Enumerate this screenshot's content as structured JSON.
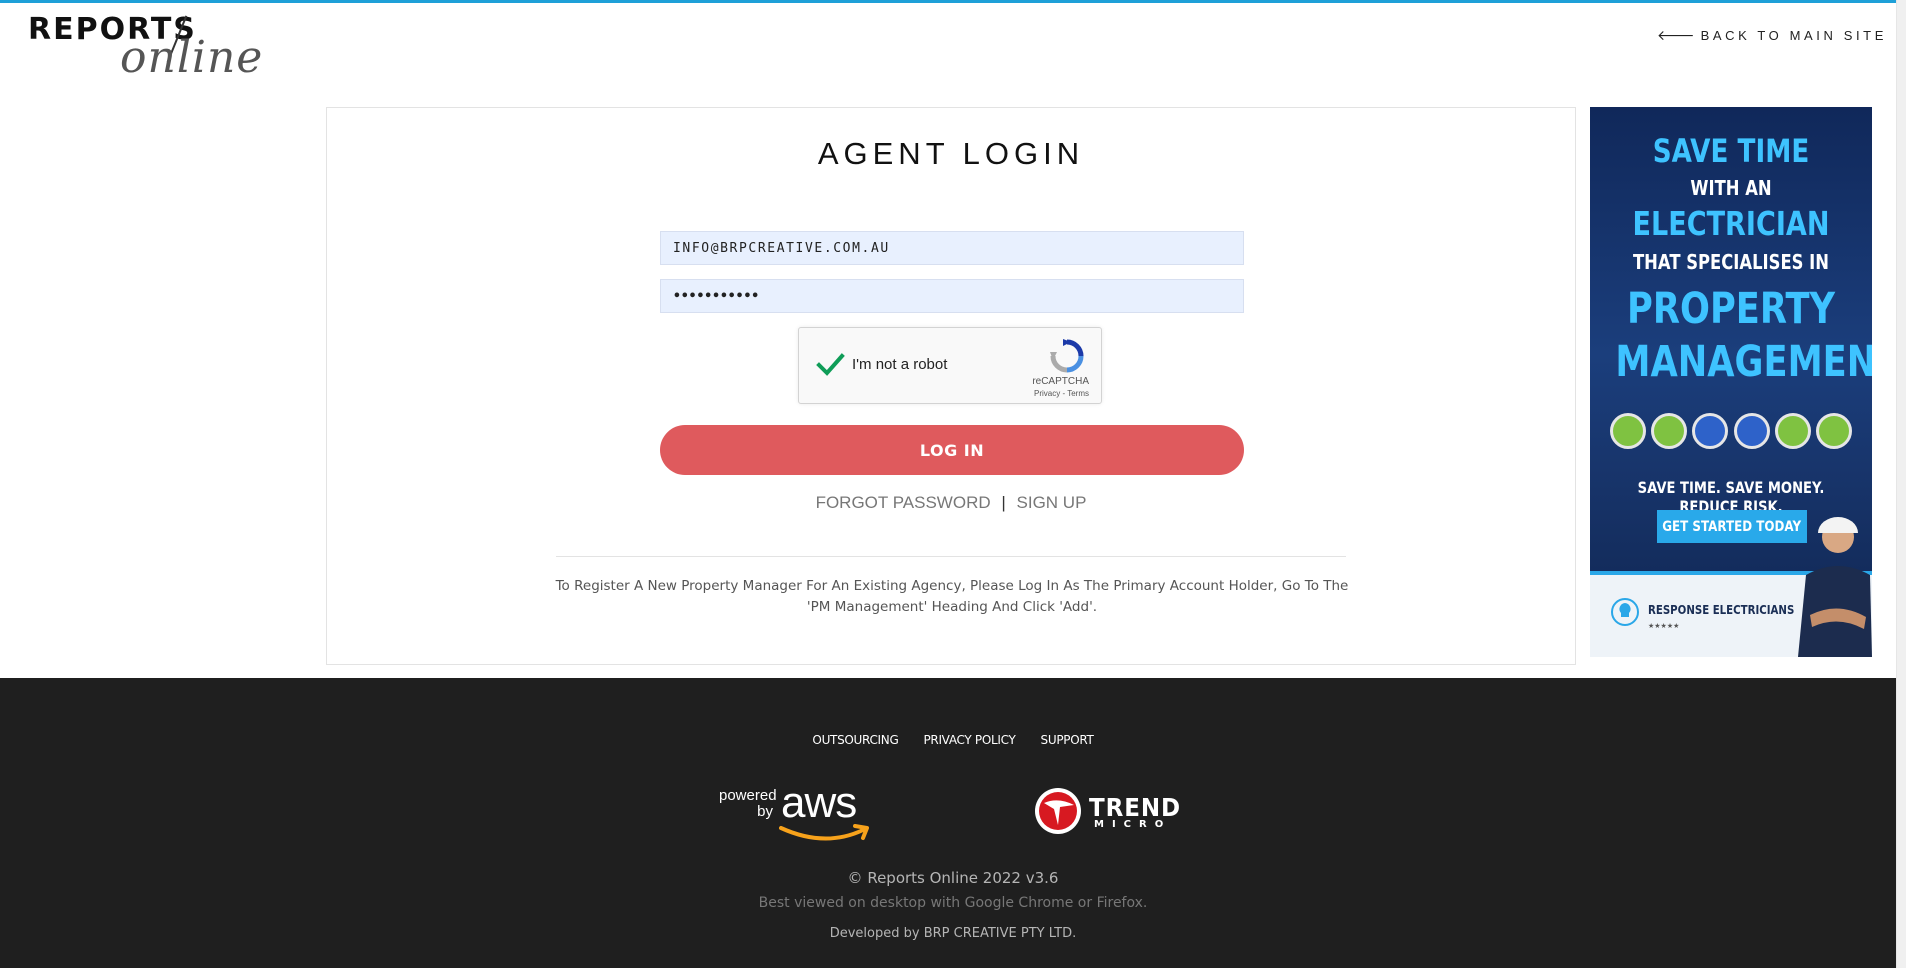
{
  "header": {
    "logo_main": "REPORTS",
    "logo_script": "online",
    "back_link": "BACK TO MAIN SITE",
    "back_icon": "arrow-left-icon"
  },
  "login": {
    "title": "AGENT LOGIN",
    "email_value": "INFO@BRPCREATIVE.COM.AU",
    "password_value": "•••••••••••",
    "captcha": {
      "label": "I'm not a robot",
      "brand": "reCAPTCHA",
      "links": "Privacy - Terms",
      "checked": true
    },
    "login_button": "LOG IN",
    "forgot_password": "FORGOT PASSWORD",
    "separator": "|",
    "sign_up": "SIGN UP",
    "note": "To Register A New Property Manager For An Existing Agency, Please Log In As The Primary Account Holder, Go To The 'PM Management' Heading And Click 'Add'."
  },
  "ad": {
    "line1": "SAVE TIME",
    "line2": "WITH AN",
    "line3": "ELECTRICIAN",
    "line4": "THAT SPECIALISES IN",
    "line5": "PROPERTY",
    "line6": "MANAGEMENT",
    "tagline": "SAVE TIME. SAVE MONEY. REDUCE RISK.",
    "cta": "GET STARTED TODAY",
    "brand": "RESPONSE ELECTRICIANS",
    "colors": {
      "blue_text": "#3ec3ff",
      "background": "#1b3e7c",
      "cta": "#29a9ea"
    }
  },
  "footer": {
    "nav": [
      "OUTSOURCING",
      "PRIVACY POLICY",
      "SUPPORT"
    ],
    "aws_powered": "powered by",
    "aws_word": "aws",
    "trend_word": "TREND",
    "trend_sub": "MICRO",
    "copyright": "© Reports Online 2022 v3.6",
    "browser_note": "Best viewed on desktop with Google Chrome or Firefox.",
    "dev_note": "Developed by BRP CREATIVE PTY LTD."
  },
  "colors": {
    "accent_top": "#1ea0d8",
    "login_button": "#df5a5d",
    "input_bg": "#e8f0fe",
    "footer_bg": "#1f1f1f"
  }
}
